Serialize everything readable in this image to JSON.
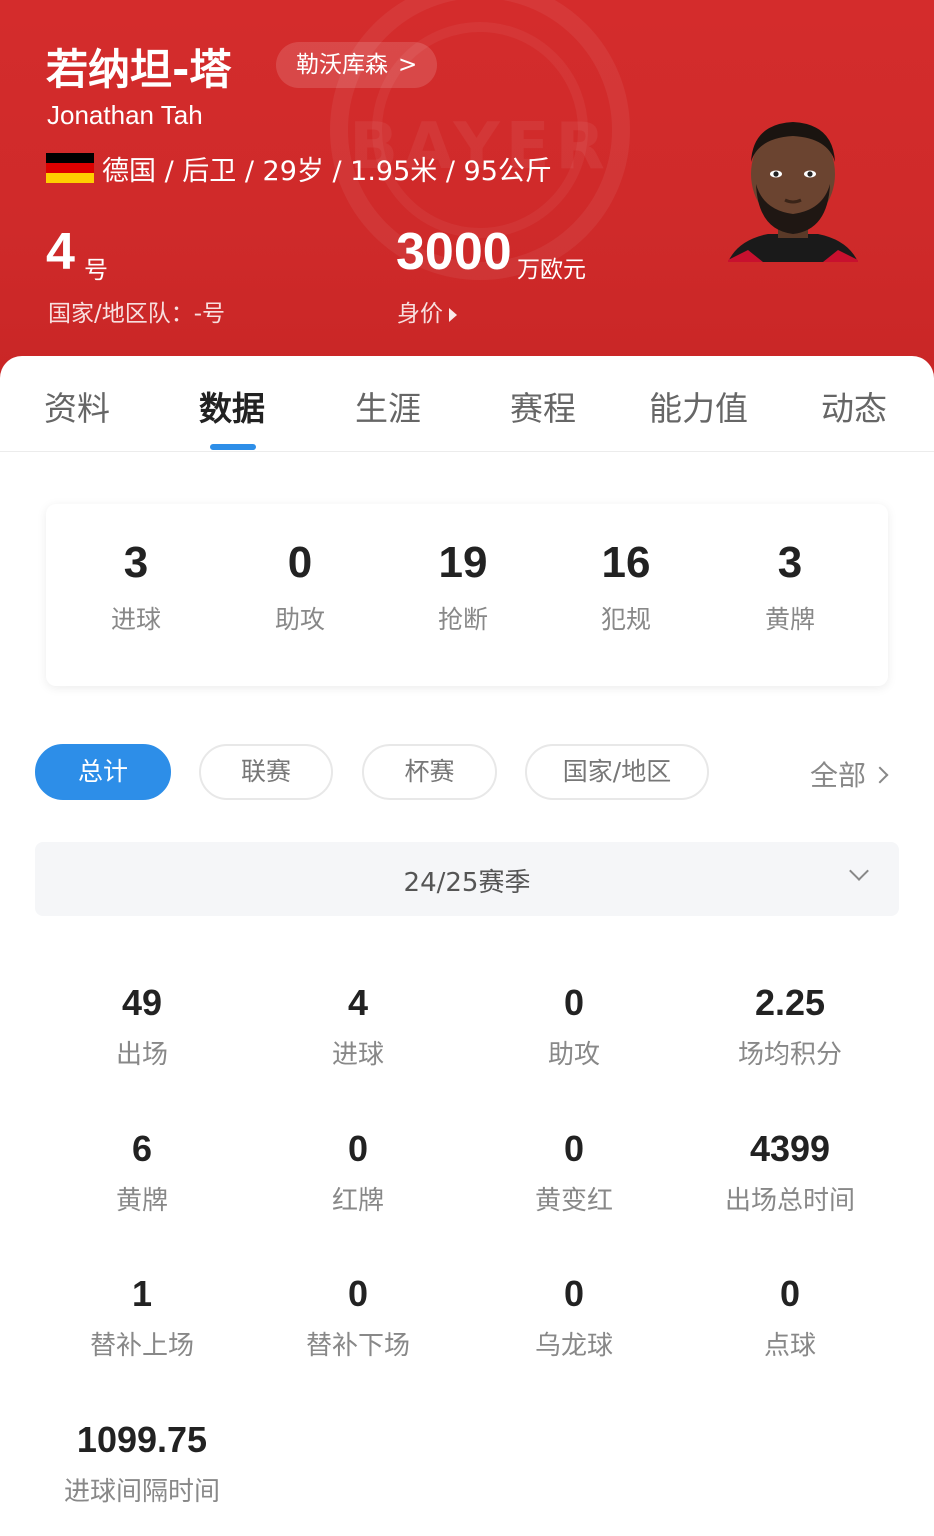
{
  "header": {
    "name_cn": "若纳坦-塔",
    "club": "勒沃库森",
    "club_chevron": ">",
    "name_en": "Jonathan Tah",
    "flag_icon": "germany-flag-icon",
    "flag_colors": [
      "#000000",
      "#dd0000",
      "#ffce00"
    ],
    "info": "德国 / 后卫 / 29岁 / 1.95米 / 95公斤",
    "shirt_number": "4",
    "shirt_unit": "号",
    "national_team": "国家/地区队：-号",
    "market_value": "3000",
    "market_value_unit": "万欧元",
    "market_value_label": "身价",
    "background_color": "#d42c2c"
  },
  "tabs": [
    {
      "label": "资料",
      "active": false
    },
    {
      "label": "数据",
      "active": true
    },
    {
      "label": "生涯",
      "active": false
    },
    {
      "label": "赛程",
      "active": false
    },
    {
      "label": "能力值",
      "active": false
    },
    {
      "label": "动态",
      "active": false
    }
  ],
  "summary": [
    {
      "value": "3",
      "label": "进球"
    },
    {
      "value": "0",
      "label": "助攻"
    },
    {
      "value": "19",
      "label": "抢断"
    },
    {
      "value": "16",
      "label": "犯规"
    },
    {
      "value": "3",
      "label": "黄牌"
    }
  ],
  "filters": [
    {
      "label": "总计",
      "active": true
    },
    {
      "label": "联赛",
      "active": false
    },
    {
      "label": "杯赛",
      "active": false
    },
    {
      "label": "国家/地区",
      "active": false
    }
  ],
  "all_link": "全部",
  "season": "24/25赛季",
  "stats": [
    {
      "value": "49",
      "label": "出场"
    },
    {
      "value": "4",
      "label": "进球"
    },
    {
      "value": "0",
      "label": "助攻"
    },
    {
      "value": "2.25",
      "label": "场均积分"
    },
    {
      "value": "6",
      "label": "黄牌"
    },
    {
      "value": "0",
      "label": "红牌"
    },
    {
      "value": "0",
      "label": "黄变红"
    },
    {
      "value": "4399",
      "label": "出场总时间"
    },
    {
      "value": "1",
      "label": "替补上场"
    },
    {
      "value": "0",
      "label": "替补下场"
    },
    {
      "value": "0",
      "label": "乌龙球"
    },
    {
      "value": "0",
      "label": "点球"
    },
    {
      "value": "1099.75",
      "label": "进球间隔时间"
    }
  ],
  "accent_color": "#2d8ee8"
}
